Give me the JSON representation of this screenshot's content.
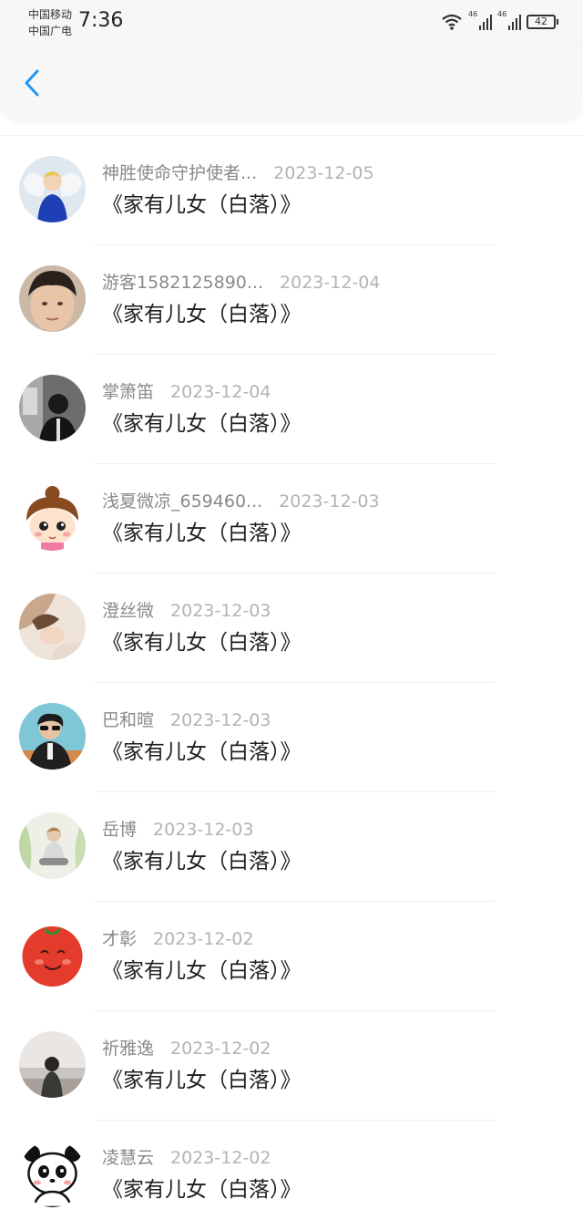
{
  "status_bar": {
    "carrier_1": "中国移动",
    "carrier_2": "中国广电",
    "time": "7:36",
    "signal_1_tag": "46",
    "signal_2_tag": "46",
    "battery": "42"
  },
  "header": {
    "back_icon": "chevron-left-icon",
    "accent_color": "#2196f3"
  },
  "items": [
    {
      "name": "神胜使命守护使者...",
      "date": "2023-12-05",
      "title": "《家有儿女（白落）》",
      "avatar_icon": "angel-boy-avatar-icon"
    },
    {
      "name": "游客1582125890...",
      "date": "2023-12-04",
      "title": "《家有儿女（白落）》",
      "avatar_icon": "boy-face-avatar-icon"
    },
    {
      "name": "掌箫笛",
      "date": "2023-12-04",
      "title": "《家有儿女（白落）》",
      "avatar_icon": "dark-portrait-avatar-icon"
    },
    {
      "name": "浅夏微凉_659460...",
      "date": "2023-12-03",
      "title": "《家有儿女（白落）》",
      "avatar_icon": "cartoon-girl-avatar-icon"
    },
    {
      "name": "澄丝微",
      "date": "2023-12-03",
      "title": "《家有儿女（白落）》",
      "avatar_icon": "soft-photo-avatar-icon"
    },
    {
      "name": "巴和暄",
      "date": "2023-12-03",
      "title": "《家有儿女（白落）》",
      "avatar_icon": "sunglasses-man-avatar-icon"
    },
    {
      "name": "岳博",
      "date": "2023-12-03",
      "title": "《家有儿女（白落）》",
      "avatar_icon": "sitting-girl-avatar-icon"
    },
    {
      "name": "才彰",
      "date": "2023-12-02",
      "title": "《家有儿女（白落）》",
      "avatar_icon": "tomato-face-avatar-icon"
    },
    {
      "name": "祈雅逸",
      "date": "2023-12-02",
      "title": "《家有儿女（白落）》",
      "avatar_icon": "seaside-girl-avatar-icon"
    },
    {
      "name": "凌慧云",
      "date": "2023-12-02",
      "title": "《家有儿女（白落）》",
      "avatar_icon": "panda-cartoon-avatar-icon"
    }
  ]
}
